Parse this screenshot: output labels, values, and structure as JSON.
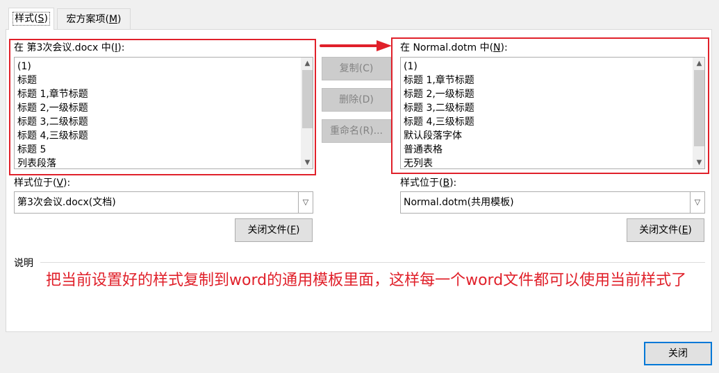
{
  "tabs": [
    {
      "label": "样式",
      "key": "S"
    },
    {
      "label": "宏方案项",
      "key": "M"
    }
  ],
  "left": {
    "header_prefix": "在 第3次会议.docx 中(",
    "header_key": "I",
    "header_suffix": "):",
    "items": [
      "(1)",
      "标题",
      "标题 1,章节标题",
      "标题 2,一级标题",
      "标题 3,二级标题",
      "标题 4,三级标题",
      "标题 5",
      "列表段落"
    ],
    "location_label_prefix": "样式位于(",
    "location_key": "V",
    "location_label_suffix": "):",
    "location_value": "第3次会议.docx(文档)",
    "close_file_prefix": "关闭文件(",
    "close_file_key": "F",
    "close_file_suffix": ")"
  },
  "right": {
    "header_prefix": "在 Normal.dotm 中(",
    "header_key": "N",
    "header_suffix": "):",
    "items": [
      "(1)",
      "标题 1,章节标题",
      "标题 2,一级标题",
      "标题 3,二级标题",
      "标题 4,三级标题",
      "默认段落字体",
      "普通表格",
      "无列表"
    ],
    "location_label_prefix": "样式位于(",
    "location_key": "B",
    "location_label_suffix": "):",
    "location_value": "Normal.dotm(共用模板)",
    "close_file_prefix": "关闭文件(",
    "close_file_key": "E",
    "close_file_suffix": ")"
  },
  "middle_buttons": {
    "copy": "复制(C)",
    "delete": "删除(D)",
    "rename": "重命名(R)..."
  },
  "description_label": "说明",
  "annotation": "把当前设置好的样式复制到word的通用模板里面，这样每一个word文件都可以使用当前样式了",
  "close_button": "关闭",
  "colors": {
    "annotation_red": "#e0202a",
    "accent_blue": "#0078d7"
  }
}
